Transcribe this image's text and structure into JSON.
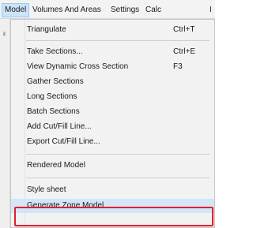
{
  "menubar": {
    "items": [
      "Model",
      "Volumes And Areas",
      "Settings",
      "Calc",
      "I"
    ]
  },
  "left_strip": {
    "mark": "ε"
  },
  "menu": {
    "items": [
      {
        "label": "Triangulate",
        "shortcut": "Ctrl+T"
      },
      {
        "label": "Take Sections...",
        "shortcut": "Ctrl+E"
      },
      {
        "label": "View Dynamic Cross Section",
        "shortcut": "F3"
      },
      {
        "label": "Gather Sections",
        "shortcut": ""
      },
      {
        "label": "Long Sections",
        "shortcut": ""
      },
      {
        "label": "Batch Sections",
        "shortcut": ""
      },
      {
        "label": "Add Cut/Fill Line...",
        "shortcut": ""
      },
      {
        "label": "Export Cut/Fill Line...",
        "shortcut": ""
      },
      {
        "label": "Rendered Model",
        "shortcut": ""
      },
      {
        "label": "Style sheet",
        "shortcut": ""
      },
      {
        "label": "Generate Zone Model",
        "shortcut": ""
      }
    ]
  },
  "colors": {
    "highlight_border": "#e0202e",
    "menu_hover": "#d2e6f7"
  }
}
